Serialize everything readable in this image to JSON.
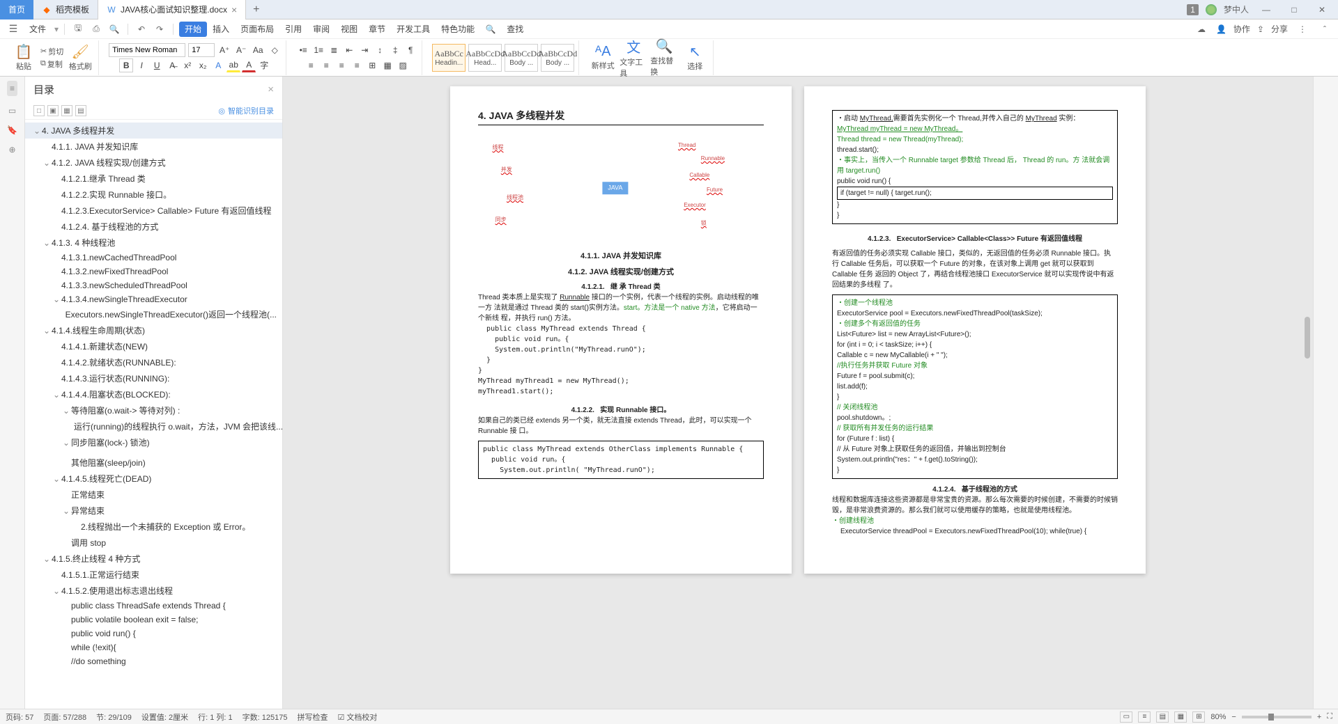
{
  "tabs": {
    "home": "首页",
    "template": "稻壳模板",
    "doc": "JAVA核心面试知识整理.docx",
    "add": "+"
  },
  "titlebar": {
    "badge": "1",
    "user": "梦中人"
  },
  "menu": {
    "file": "文件",
    "items": [
      "开始",
      "插入",
      "页面布局",
      "引用",
      "审阅",
      "视图",
      "章节",
      "开发工具",
      "特色功能"
    ],
    "search": "查找",
    "cloud": "协作",
    "share": "分享"
  },
  "ribbon": {
    "paste": "粘贴",
    "cut": "剪切",
    "copy": "复制",
    "format_painter": "格式刷",
    "font_name": "Times New Roman",
    "font_size": "17",
    "styles": [
      {
        "preview": "AaBbCc",
        "label": "Headin..."
      },
      {
        "preview": "AaBbCcDd",
        "label": "Head..."
      },
      {
        "preview": "AaBbCcDd",
        "label": "Body ..."
      },
      {
        "preview": "AaBbCcDd",
        "label": "Body ..."
      }
    ],
    "new_style": "新样式",
    "text_tool": "文字工具",
    "find_replace": "查找替换",
    "select": "选择"
  },
  "nav": {
    "title": "目录",
    "smart": "智能识别目录",
    "items": [
      {
        "t": "4. JAVA 多线程并发",
        "l": 0,
        "tw": "v",
        "active": true
      },
      {
        "t": "4.1.1. JAVA 并发知识库",
        "l": 1,
        "tw": ""
      },
      {
        "t": "4.1.2. JAVA 线程实现/创建方式",
        "l": 1,
        "tw": "v"
      },
      {
        "t": "4.1.2.1.继承 Thread 类",
        "l": 2,
        "tw": ""
      },
      {
        "t": "4.1.2.2.实现 Runnable 接口。",
        "l": 2,
        "tw": ""
      },
      {
        "t": "4.1.2.3.ExecutorService> Callable<Class>> Future 有返回值线程",
        "l": 2,
        "tw": ""
      },
      {
        "t": "4.1.2.4. 基于线程池的方式",
        "l": 2,
        "tw": ""
      },
      {
        "t": "4.1.3. 4 种线程池",
        "l": 1,
        "tw": "v"
      },
      {
        "t": "4.1.3.1.newCachedThreadPool",
        "l": 2,
        "tw": ""
      },
      {
        "t": "4.1.3.2.newFixedThreadPool",
        "l": 2,
        "tw": ""
      },
      {
        "t": "4.1.3.3.newScheduledThreadPool",
        "l": 2,
        "tw": ""
      },
      {
        "t": "4.1.3.4.newSingleThreadExecutor",
        "l": 2,
        "tw": "v"
      },
      {
        "t": "Executors.newSingleThreadExecutor()返回一个线程池(...",
        "l": 3,
        "tw": ""
      },
      {
        "t": "4.1.4.线程生命周期(状态)",
        "l": 1,
        "tw": "v"
      },
      {
        "t": "4.1.4.1.新建状态(NEW)",
        "l": 2,
        "tw": ""
      },
      {
        "t": "4.1.4.2.就绪状态(RUNNABLE):",
        "l": 2,
        "tw": ""
      },
      {
        "t": "4.1.4.3.运行状态(RUNNING):",
        "l": 2,
        "tw": ""
      },
      {
        "t": "4.1.4.4.阻塞状态(BLOCKED):",
        "l": 2,
        "tw": "v"
      },
      {
        "t": "等待阻塞(o.wait-> 等待对列) :",
        "l": 3,
        "tw": "v"
      },
      {
        "t": "运行(running)的线程执行 o.wait，方法，JVM 会把该线...",
        "l": 4,
        "tw": ""
      },
      {
        "t": "同步阻塞(lock-) 锁池)",
        "l": 3,
        "tw": "v"
      },
      {
        "t": "",
        "l": 4,
        "tw": ""
      },
      {
        "t": "其他阻塞(sleep/join)",
        "l": 3,
        "tw": ""
      },
      {
        "t": "4.1.4.5.线程死亡(DEAD)",
        "l": 2,
        "tw": "v"
      },
      {
        "t": "正常结束",
        "l": 3,
        "tw": ""
      },
      {
        "t": "异常结束",
        "l": 3,
        "tw": "v"
      },
      {
        "t": "2.线程抛出一个未捕获的 Exception 或 Error。",
        "l": 4,
        "tw": ""
      },
      {
        "t": "调用 stop",
        "l": 3,
        "tw": ""
      },
      {
        "t": "4.1.5.终止线程 4 种方式",
        "l": 1,
        "tw": "v"
      },
      {
        "t": "4.1.5.1.正常运行结束",
        "l": 2,
        "tw": ""
      },
      {
        "t": "4.1.5.2.使用退出标志退出线程",
        "l": 2,
        "tw": "v"
      },
      {
        "t": "public class ThreadSafe extends Thread {",
        "l": 3,
        "tw": ""
      },
      {
        "t": "public volatile boolean exit = false;",
        "l": 3,
        "tw": ""
      },
      {
        "t": "public void run() {",
        "l": 3,
        "tw": ""
      },
      {
        "t": "while (!exit){",
        "l": 3,
        "tw": ""
      },
      {
        "t": "//do something",
        "l": 3,
        "tw": ""
      }
    ]
  },
  "doc_left": {
    "h": "4. JAVA 多线程并发",
    "s411": "4.1.1. JAVA 并发知识库",
    "s412": "4.1.2. JAVA 线程实现/创建方式",
    "s4121": "4.1.2.1.",
    "s4121t": "继 承 Thread 类",
    "p1a": "Thread 类本质上是实现了 ",
    "p1b": "Runnable",
    "p1c": " 接口的一个实例，代表一个线程的实例。启动线程的唯一方 法就是通过 Thread 类的 start()实例方法。",
    "p1d": "start。方法是一个 native 方法",
    "p1e": "，它将启动一个新线 程，并执行 run() 方法。",
    "c1": "  public class MyThread extends Thread {\n    public void run。{\n    System.out.println(\"MyThread.runO\");\n  }\n}\nMyThread myThread1 = new MyThread();\nmyThread1.start();",
    "s4122": "4.1.2.2.",
    "s4122t": "实现 Runnable 接口。",
    "p2": "如果自己的类已经 extends 另一个类，就无法直接 extends Thread，此时，可以实现一个 Runnable 接 口。",
    "c2": "public class MyThread extends OtherClass implements Runnable {\n  public void run。{\n    System.out.println( \"MyThread.runO\");",
    "mm_center": "JAVA"
  },
  "doc_right": {
    "r1a": "・启动 ",
    "r1b": "MyThread,",
    "r1c": "需要首先实例化一个 Thread,并传入自己的 ",
    "r1d": "MyThread",
    "r1e": " 实例：",
    "r1f": "MyThread myThread = new MyThread。",
    "r2": "Thread thread = new Thread(myThread);",
    "r3": "thread.start();",
    "r4": "・事实上，当传入一个 Runnable target 参数给 Thread 后， Thread 的 run。方 法就会调用 target.run()",
    "r5": "public void run() {",
    "r6": "if (target != null) { target.run();",
    "r7": "}",
    "r8": "}",
    "s4123": "4.1.2.3.",
    "s4123t": "ExecutorService> Callable<Class>> Future 有返回值线程",
    "p3": "有返回值的任务必须实现 Callable 接口，类似的，无返回值的任务必须 Runnable 接口。执行 Callable 任务后，可以获取一个 Future 的对象，在该对象上调用 get 就可以获取到 Callable 任务 返回的 Object 了，再结合线程池接口 ExecutorService 就可以实现传说中有返回结果的多线程 了。",
    "code2": [
      {
        "c": "g",
        "t": "・创建一个线程池"
      },
      {
        "c": "",
        "t": "ExecutorService pool = Executors.newFixedThreadPool(taskSize);"
      },
      {
        "c": "g",
        "t": "・创建多个有返回值的任务"
      },
      {
        "c": "",
        "t": "List<Future> list = new ArrayList<Future>();"
      },
      {
        "c": "",
        "t": "for (int i = 0; i < taskSize; i++) {"
      },
      {
        "c": "",
        "t": "Callable c = new MyCallable(i + \" \");"
      },
      {
        "c": "g",
        "t": "//执行任务并获取 Future 对象"
      },
      {
        "c": "",
        "t": "Future f = pool.submit(c);"
      },
      {
        "c": "",
        "t": "list.add(f);"
      },
      {
        "c": "",
        "t": "}"
      },
      {
        "c": "g",
        "t": "// 关闭线程池"
      },
      {
        "c": "",
        "t": "pool.shutdown。;"
      },
      {
        "c": "g",
        "t": "// 获取所有并发任务的运行结果"
      },
      {
        "c": "",
        "t": "for (Future f : list) {"
      },
      {
        "c": "",
        "t": "// 从 Future 对象上获取任务的返回值，并输出到控制台"
      },
      {
        "c": "",
        "t": "System.out.println(\"res：\" + f.get().toString());"
      },
      {
        "c": "",
        "t": "}"
      }
    ],
    "s4124": "4.1.2.4.",
    "s4124t": "基于线程池的方式",
    "p4": "线程和数据库连接这些资源都是非常宝贵的资源。那么每次需要的时候创建，不需要的时候销 毁，是非常浪费资源的。那么我们就可以使用缓存的策略，也就是使用线程池。",
    "p4g": "・创建线程池",
    "p4c": "ExecutorService threadPool = Executors.newFixedThreadPool(10); while(true) {"
  },
  "status": {
    "page_no": "页码: 57",
    "pages": "页面: 57/288",
    "sec": "节: 29/109",
    "indent": "设置值: 2厘米",
    "line": "行: 1  列: 1",
    "words": "字数: 125175",
    "spell": "拼写检查",
    "proof": "文档校对",
    "zoom": "80%"
  }
}
